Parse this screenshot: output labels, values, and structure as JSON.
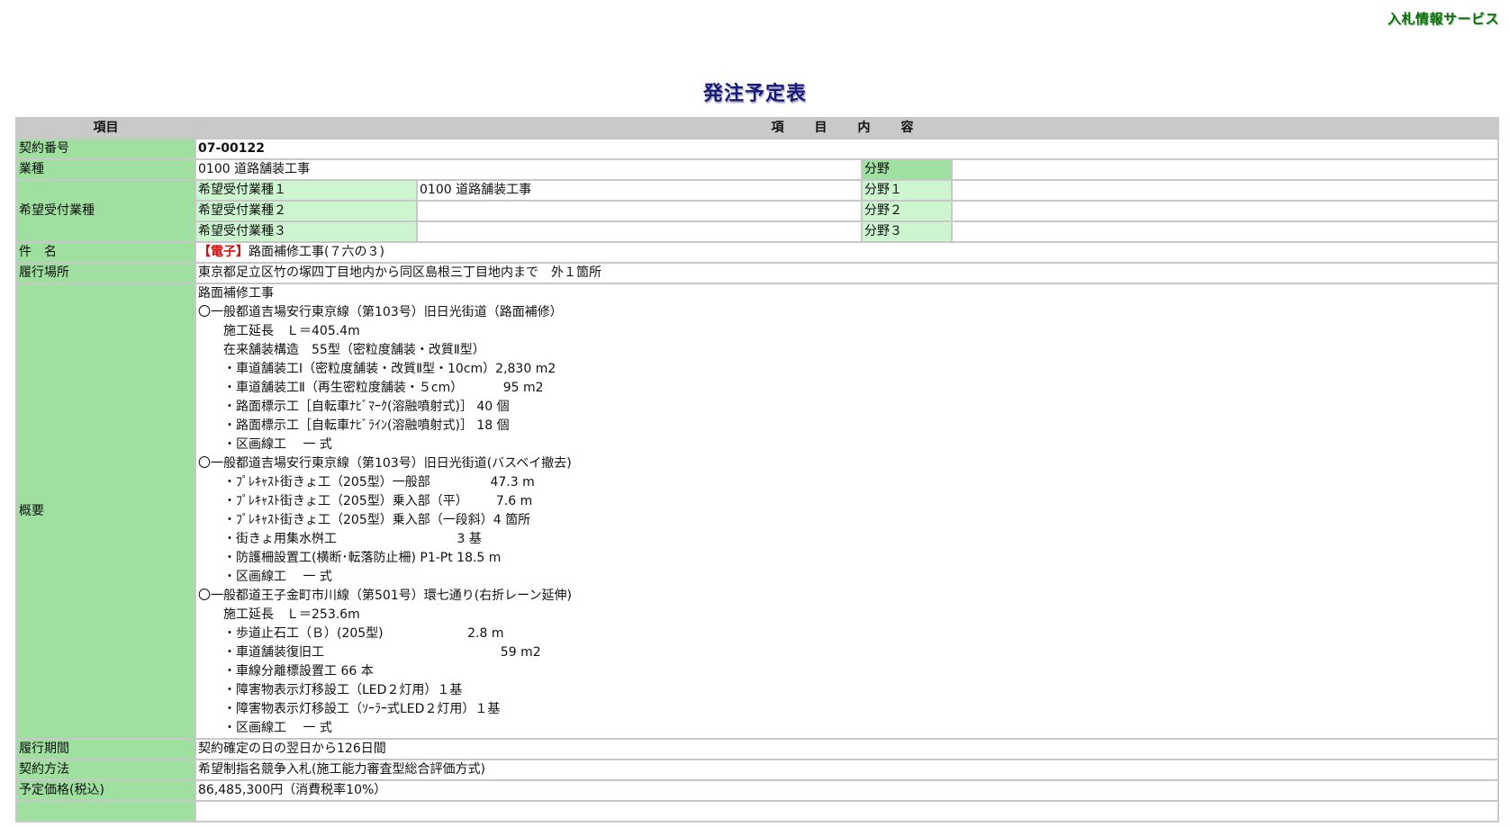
{
  "header": {
    "service_name": "入札情報サービス",
    "page_title": "発注予定表"
  },
  "table": {
    "col_item": "項目",
    "col_content": "項　目　内　容",
    "contract_no": {
      "label": "契約番号",
      "value": "07-00122"
    },
    "business_type": {
      "label": "業種",
      "value": "0100 道路舗装工事",
      "field_label": "分野",
      "field_value": ""
    },
    "desired": {
      "label": "希望受付業種",
      "rows": [
        {
          "label": "希望受付業種１",
          "value": "0100 道路舗装工事",
          "field_label": "分野１",
          "field_value": ""
        },
        {
          "label": "希望受付業種２",
          "value": "",
          "field_label": "分野２",
          "field_value": ""
        },
        {
          "label": "希望受付業種３",
          "value": "",
          "field_label": "分野３",
          "field_value": ""
        }
      ]
    },
    "subject": {
      "label": "件　名",
      "tag": "【電子】",
      "value": "路面補修工事(７六の３)"
    },
    "location": {
      "label": "履行場所",
      "value": "東京都足立区竹の塚四丁目地内から同区島根三丁目地内まで　外１箇所"
    },
    "overview": {
      "label": "概要",
      "lines": [
        {
          "text": "路面補修工事",
          "indent": 0
        },
        {
          "text": "〇一般都道吉場安行東京線（第103号）旧日光街道（路面補修）",
          "indent": 0
        },
        {
          "text": "施工延長　Ｌ＝405.4m",
          "indent": 1
        },
        {
          "text": "在来舗装構造　55型（密粒度舗装・改質Ⅱ型）",
          "indent": 1
        },
        {
          "text": "・車道舗装工Ⅰ（密粒度舗装・改質Ⅱ型・10cm）2,830 m2",
          "indent": 1
        },
        {
          "text": "・車道舗装工Ⅱ（再生密粒度舗装・５cm）          95 m2",
          "indent": 1
        },
        {
          "text": "・路面標示工［自転車ﾅﾋﾞﾏｰｸ(溶融噴射式)］ 40 個",
          "indent": 1
        },
        {
          "text": "・路面標示工［自転車ﾅﾋﾞﾗｲﾝ(溶融噴射式)］ 18 個",
          "indent": 1
        },
        {
          "text": "・区画線工　 一 式",
          "indent": 1
        },
        {
          "text": "〇一般都道吉場安行東京線（第103号）旧日光街道(バスベイ撤去)",
          "indent": 0
        },
        {
          "text": "・ﾌﾟﾚｷｬｽﾄ街きょ工（205型）一般部               47.3 m",
          "indent": 1
        },
        {
          "text": "・ﾌﾟﾚｷｬｽﾄ街きょ工（205型）乗入部（平）       7.6 m",
          "indent": 1
        },
        {
          "text": "・ﾌﾟﾚｷｬｽﾄ街きょ工（205型）乗入部（一段斜）4 箇所",
          "indent": 1
        },
        {
          "text": "・街きょ用集水桝工                              3 基",
          "indent": 1
        },
        {
          "text": "・防護柵設置工(横断･転落防止柵) P1-Pt 18.5 m",
          "indent": 1
        },
        {
          "text": "・区画線工　 一 式",
          "indent": 1
        },
        {
          "text": "〇一般都道王子金町市川線（第501号）環七通り(右折レーン延伸)",
          "indent": 0
        },
        {
          "text": "施工延長　Ｌ＝253.6m",
          "indent": 1
        },
        {
          "text": "・歩道止石工（Ｂ）(205型)                     2.8 m",
          "indent": 1
        },
        {
          "text": "・車道舗装復旧工                                            59 m2",
          "indent": 1
        },
        {
          "text": "・車線分離標設置工 66 本",
          "indent": 1
        },
        {
          "text": "・障害物表示灯移設工（LED２灯用）１基",
          "indent": 1
        },
        {
          "text": "・障害物表示灯移設工（ｿｰﾗｰ式LED２灯用）１基",
          "indent": 1
        },
        {
          "text": "・区画線工　 一 式",
          "indent": 1
        }
      ]
    },
    "period": {
      "label": "履行期間",
      "value": "契約確定の日の翌日から126日間"
    },
    "method": {
      "label": "契約方法",
      "value": "希望制指名競争入札(施工能力審査型総合評価方式)"
    },
    "price": {
      "label": "予定価格(税込)",
      "value": "86,485,300円（消費税率10%）"
    }
  }
}
